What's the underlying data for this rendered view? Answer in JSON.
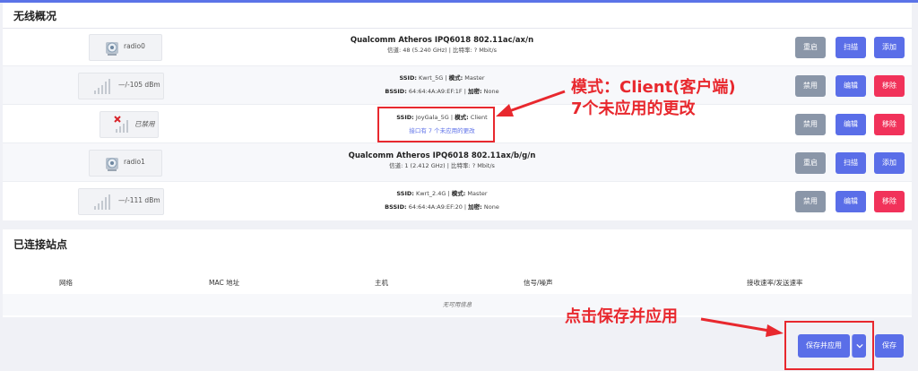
{
  "wireless_overview": {
    "title": "无线概况",
    "rows": [
      {
        "device": "radio0",
        "line1": "Qualcomm Atheros IPQ6018 802.11ac/ax/n",
        "line2": "信道: 48 (5.240 GHz) | 比特率: ? Mbit/s",
        "buttons": [
          "重启",
          "扫描",
          "添加"
        ]
      },
      {
        "device": "—/-105 dBm",
        "ssid_label": "SSID:",
        "ssid_value": "Kwrt_5G",
        "mode_label": "模式:",
        "mode_value": "Master",
        "bssid_label": "BSSID:",
        "bssid_value": "64:64:4A:A9:EF:1F",
        "enc_label": "加密:",
        "enc_value": "None",
        "buttons": [
          "禁用",
          "编辑",
          "移除"
        ]
      },
      {
        "device": "已禁用",
        "ssid_label": "SSID:",
        "ssid_value": "JoyGala_5G",
        "mode_label": "模式:",
        "mode_value": "Client",
        "pending": "接口有 7 个未应用的更改",
        "buttons": [
          "禁用",
          "编辑",
          "移除"
        ]
      },
      {
        "device": "radio1",
        "line1": "Qualcomm Atheros IPQ6018 802.11ax/b/g/n",
        "line2": "信道: 1 (2.412 GHz) | 比特率: ? Mbit/s",
        "buttons": [
          "重启",
          "扫描",
          "添加"
        ]
      },
      {
        "device": "—/-111 dBm",
        "ssid_label": "SSID:",
        "ssid_value": "Kwrt_2.4G",
        "mode_label": "模式:",
        "mode_value": "Master",
        "bssid_label": "BSSID:",
        "bssid_value": "64:64:4A:A9:EF:20",
        "enc_label": "加密:",
        "enc_value": "None",
        "buttons": [
          "禁用",
          "编辑",
          "移除"
        ]
      }
    ]
  },
  "connected_stations": {
    "title": "已连接站点",
    "columns": [
      "网络",
      "MAC 地址",
      "主机",
      "信号/噪声",
      "接收速率/发送速率"
    ],
    "empty_text": "无可用信息"
  },
  "annotations": {
    "mode_note_line1": "模式：Client(客户端)",
    "mode_note_line2": "7个未应用的更改",
    "save_note": "点击保存并应用"
  },
  "footer": {
    "save_apply": "保存并应用",
    "dropdown_icon": "chevron-down-icon",
    "save": "保存"
  },
  "colors": {
    "accent": "#5a6ee8",
    "danger": "#f1325a",
    "neutral": "#8a96a8",
    "annotation": "#e8282e"
  }
}
